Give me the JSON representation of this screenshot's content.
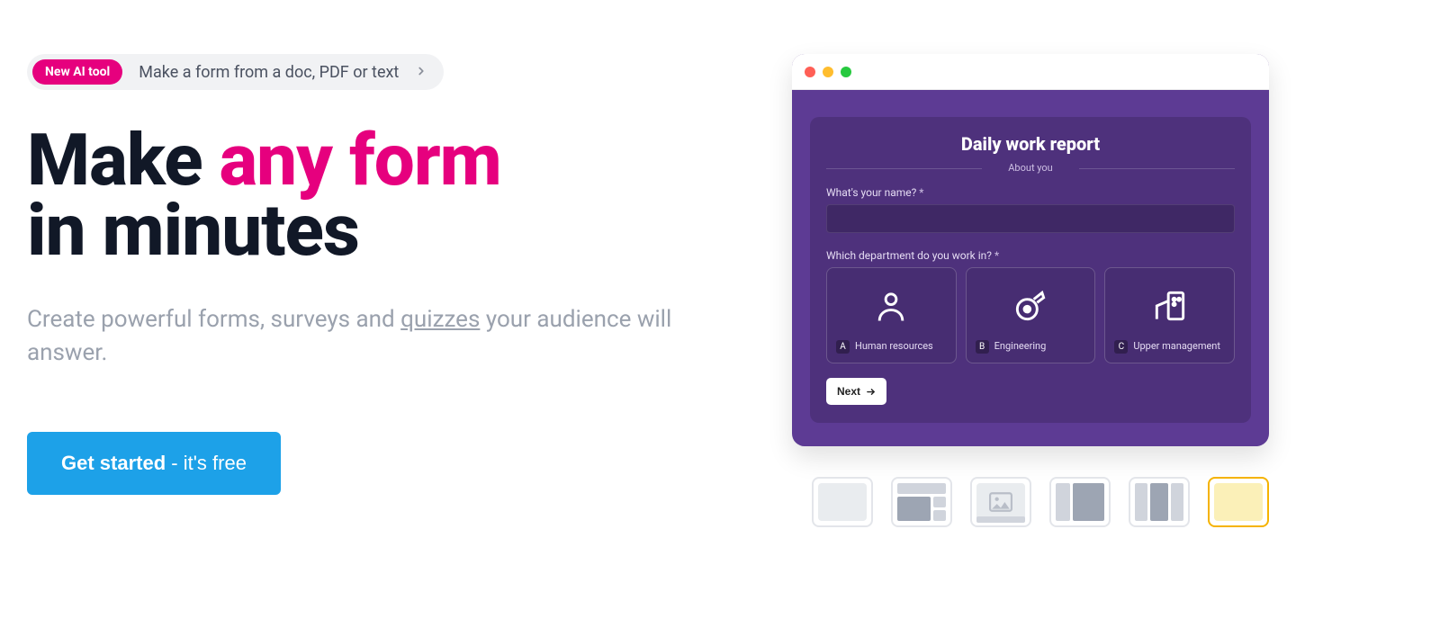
{
  "announce": {
    "badge": "New AI tool",
    "text": "Make a form from a doc, PDF or text"
  },
  "hero": {
    "make": "Make ",
    "accent": "any form",
    "rest": "in minutes",
    "sub_start": "Create powerful forms, surveys and ",
    "sub_link": "quizzes",
    "sub_end": " your audience will answer.",
    "cta_bold": "Get started",
    "cta_rest": " - it's free"
  },
  "preview": {
    "title": "Daily work report",
    "section": "About you",
    "q1_label": "What's your name?",
    "q2_label": "Which department do you work in?",
    "options": [
      {
        "key": "A",
        "label": "Human resources"
      },
      {
        "key": "B",
        "label": "Engineering"
      },
      {
        "key": "C",
        "label": "Upper management"
      }
    ],
    "next": "Next"
  },
  "thumbnails": {
    "active_index": 5
  }
}
